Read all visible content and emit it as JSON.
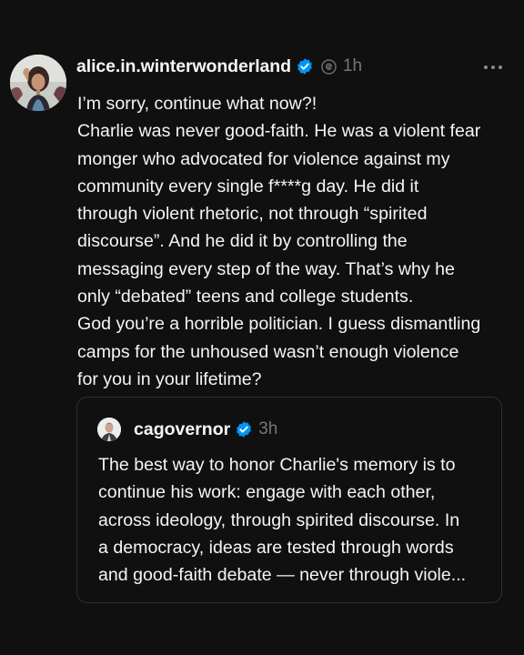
{
  "post": {
    "username": "alice.in.winterwonderland",
    "time": "1h",
    "icons": {
      "avatar": "profile-photo-woman",
      "verified": "verified-badge-icon",
      "thread": "threads-icon",
      "more": "more-horizontal-icon"
    },
    "lines": [
      "I’m sorry, continue what now?!",
      "Charlie was never good-faith. He was a violent fear",
      "monger who advocated for violence against my",
      "community every single f****g day. He did it",
      "through violent rhetoric, not through “spirited",
      "discourse”. And he did it by controlling the",
      "messaging every step of the way. That’s why he",
      "only “debated” teens and college students.",
      "God you’re a horrible politician. I guess dismantling",
      "camps for the unhoused wasn’t enough violence",
      "for you in your lifetime?"
    ]
  },
  "quote": {
    "username": "cagovernor",
    "time": "3h",
    "icons": {
      "avatar": "profile-photo-man",
      "verified": "verified-badge-icon"
    },
    "lines": [
      "The best way to honor Charlie's memory is to",
      "continue his work: engage with each other,",
      "across ideology, through spirited discourse. In",
      "a democracy, ideas are tested through words",
      "and good-faith debate — never through viole..."
    ]
  },
  "colors": {
    "background": "#101010",
    "text": "#f3f5f7",
    "muted": "#777777",
    "verified": "#0095f6",
    "border": "#2f2f2f"
  }
}
